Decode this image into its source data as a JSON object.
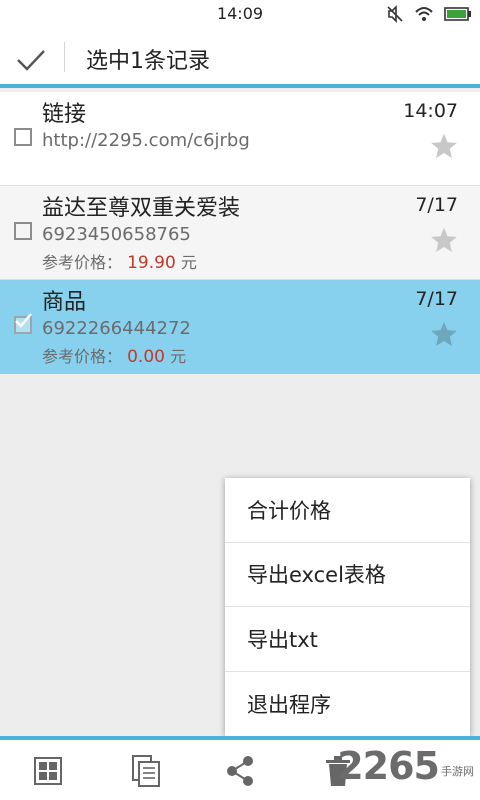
{
  "status_bar": {
    "time": "14:09"
  },
  "header": {
    "title": "选中1条记录"
  },
  "records": [
    {
      "title": "链接",
      "subtitle": "http://2295.com/c6jrbg",
      "time": "14:07",
      "price_label": "",
      "price": "",
      "currency": "",
      "selected": false
    },
    {
      "title": "益达至尊双重关爱装",
      "subtitle": "6923450658765",
      "time": "7/17",
      "price_label": "参考价格：",
      "price": "19.90",
      "currency": "元",
      "selected": false
    },
    {
      "title": "商品",
      "subtitle": "6922266444272",
      "time": "7/17",
      "price_label": "参考价格：",
      "price": "0.00",
      "currency": "元",
      "selected": true
    }
  ],
  "menu": {
    "items": [
      {
        "label": "合计价格"
      },
      {
        "label": "导出excel表格"
      },
      {
        "label": "导出txt"
      },
      {
        "label": "退出程序"
      }
    ]
  },
  "watermark": {
    "number": "2265",
    "text_top": "手游网",
    "text_bottom": ""
  },
  "colors": {
    "accent": "#4bb3db",
    "selected_row": "#87d1ee",
    "price": "#c0392b"
  },
  "icons": {
    "status": [
      "mute-icon",
      "wifi-icon",
      "battery-icon"
    ],
    "bottom": [
      "grid-icon",
      "copy-icon",
      "share-icon",
      "trash-icon"
    ]
  }
}
